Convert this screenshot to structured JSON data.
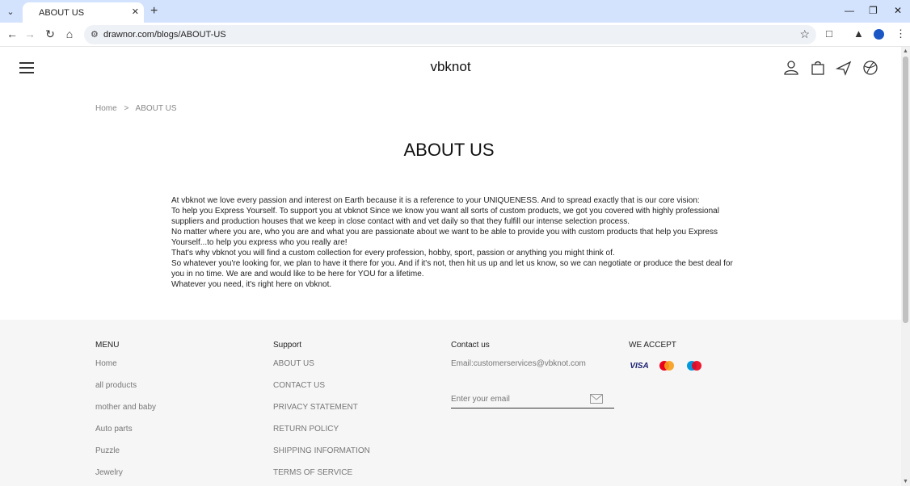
{
  "browser": {
    "tab_title": "ABOUT US",
    "url": "drawnor.com/blogs/ABOUT-US"
  },
  "header": {
    "logo": "vbknot"
  },
  "breadcrumb": {
    "home": "Home",
    "separator": ">",
    "current": "ABOUT US"
  },
  "page": {
    "title": "ABOUT US",
    "lines": [
      "At vbknot we love every passion and interest on Earth because it is a reference to your UNIQUENESS. And to spread exactly that is our core vision:",
      "To help you Express Yourself. To support you at vbknot Since we know you want all sorts of custom products, we got you covered with highly professional suppliers and production houses that we keep in close contact with and vet daily so that they fulfill our intense selection process.",
      "No matter where you are, who you are and what you are passionate about we want to be able to provide you with custom products that help you Express Yourself...to help you express who you really are!",
      "That's why vbknot you will find a custom collection for every profession, hobby, sport, passion or anything you might think of.",
      "So whatever you're looking for, we plan to have it there for you. And if it's not, then hit us up and let us know, so we can negotiate or produce the best deal for you in no time. We are and would like to be here for YOU for a lifetime.",
      "Whatever you need, it's right here on vbknot."
    ]
  },
  "footer": {
    "menu": {
      "heading": "MENU",
      "links": [
        "Home",
        "all products",
        "mother and baby",
        "Auto parts",
        "Puzzle",
        "Jewelry"
      ]
    },
    "support": {
      "heading": "Support",
      "links": [
        "ABOUT US",
        "CONTACT US",
        "PRIVACY STATEMENT",
        "RETURN POLICY",
        "SHIPPING INFORMATION",
        "TERMS OF SERVICE"
      ]
    },
    "contact": {
      "heading": "Contact us",
      "email": "Email:customerservices@vbknot.com",
      "subscribe_placeholder": "Enter your email"
    },
    "accept": {
      "heading": "WE ACCEPT",
      "cards": [
        "VISA",
        "mastercard",
        "maestro"
      ]
    }
  },
  "colors": {
    "chrome_bg": "#d3e3fd",
    "footer_bg": "#f6f6f6",
    "link_gray": "#777777"
  }
}
